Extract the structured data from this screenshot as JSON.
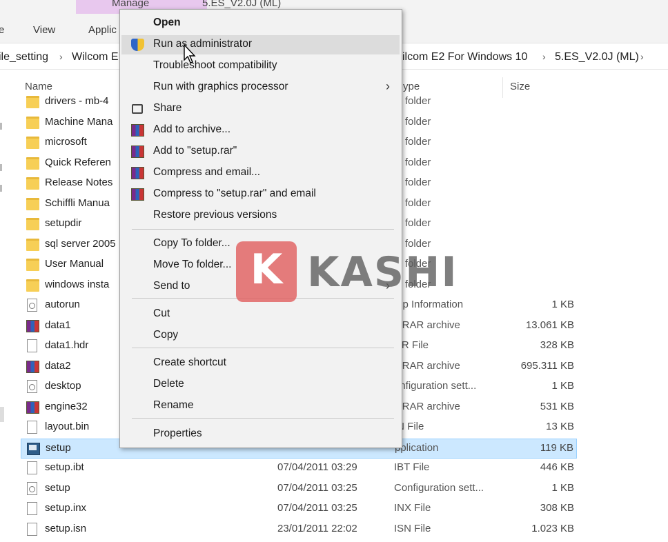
{
  "ribbon": {
    "manage_tab": "Manage",
    "window_title": "5.ES_V2.0J (ML)",
    "tab_file_fragment": "e",
    "tab_view": "View",
    "tab_application_fragment": "Applic"
  },
  "breadcrumb": {
    "left_fragment": "ile_setting",
    "wilcom_fragment": "Wilcom E",
    "right_fragment": "ilcom E2 For Windows 10",
    "current": "5.ES_V2.0J (ML)",
    "separator": "›"
  },
  "columns": {
    "name": "Name",
    "type_fragment": "ype",
    "size": "Size"
  },
  "files": [
    {
      "name": "drivers - mb-4",
      "date": "",
      "type": "le folder",
      "size": "",
      "icon": "folder-icon"
    },
    {
      "name": "Machine Mana",
      "date": "",
      "type": "le folder",
      "size": "",
      "icon": "folder-icon"
    },
    {
      "name": "microsoft",
      "date": "",
      "type": "le folder",
      "size": "",
      "icon": "folder-icon"
    },
    {
      "name": "Quick Referen",
      "date": "",
      "type": "le folder",
      "size": "",
      "icon": "folder-icon"
    },
    {
      "name": "Release Notes",
      "date": "",
      "type": "le folder",
      "size": "",
      "icon": "folder-icon"
    },
    {
      "name": "Schiffli Manua",
      "date": "",
      "type": "le folder",
      "size": "",
      "icon": "folder-icon"
    },
    {
      "name": "setupdir",
      "date": "",
      "type": "le folder",
      "size": "",
      "icon": "folder-icon"
    },
    {
      "name": "sql server 2005",
      "date": "",
      "type": "le folder",
      "size": "",
      "icon": "folder-icon"
    },
    {
      "name": "User Manual",
      "date": "",
      "type": "le folder",
      "size": "",
      "icon": "folder-icon"
    },
    {
      "name": "windows insta",
      "date": "",
      "type": "le folder",
      "size": "",
      "icon": "folder-icon"
    },
    {
      "name": "autorun",
      "date": "",
      "type": "tup Information",
      "size": "1 KB",
      "icon": "config-file-icon"
    },
    {
      "name": "data1",
      "date": "",
      "type": "inRAR archive",
      "size": "13.061 KB",
      "icon": "winrar-icon"
    },
    {
      "name": "data1.hdr",
      "date": "",
      "type": "DR File",
      "size": "328 KB",
      "icon": "document-icon"
    },
    {
      "name": "data2",
      "date": "",
      "type": "inRAR archive",
      "size": "695.311 KB",
      "icon": "winrar-icon"
    },
    {
      "name": "desktop",
      "date": "",
      "type": "onfiguration sett...",
      "size": "1 KB",
      "icon": "config-file-icon"
    },
    {
      "name": "engine32",
      "date": "",
      "type": "inRAR archive",
      "size": "531 KB",
      "icon": "winrar-icon"
    },
    {
      "name": "layout.bin",
      "date": "",
      "type": "IN File",
      "size": "13 KB",
      "icon": "document-icon"
    },
    {
      "name": "setup",
      "date": "",
      "type": "pplication",
      "size": "119 KB",
      "icon": "application-icon",
      "selected": true
    },
    {
      "name": "setup.ibt",
      "date": "07/04/2011 03:29",
      "type": "IBT File",
      "size": "446 KB",
      "icon": "document-icon"
    },
    {
      "name": "setup",
      "date": "07/04/2011 03:25",
      "type": "Configuration sett...",
      "size": "1 KB",
      "icon": "config-file-icon"
    },
    {
      "name": "setup.inx",
      "date": "07/04/2011 03:25",
      "type": "INX File",
      "size": "308 KB",
      "icon": "document-icon"
    },
    {
      "name": "setup.isn",
      "date": "23/01/2011 22:02",
      "type": "ISN File",
      "size": "1.023 KB",
      "icon": "document-icon"
    }
  ],
  "context_menu": {
    "items": [
      {
        "label": "Open",
        "bold": true
      },
      {
        "label": "Run as administrator",
        "icon": "uac-shield-icon",
        "hover": true
      },
      {
        "label": "Troubleshoot compatibility"
      },
      {
        "label": "Run with graphics processor",
        "submenu": true
      },
      {
        "label": "Share",
        "icon": "share-icon"
      },
      {
        "label": "Add to archive...",
        "icon": "winrar-icon"
      },
      {
        "label": "Add to \"setup.rar\"",
        "icon": "winrar-icon"
      },
      {
        "label": "Compress and email...",
        "icon": "winrar-icon"
      },
      {
        "label": "Compress to \"setup.rar\" and email",
        "icon": "winrar-icon"
      },
      {
        "label": "Restore previous versions"
      },
      {
        "label": "Copy To folder..."
      },
      {
        "label": "Move To folder..."
      },
      {
        "label": "Send to",
        "submenu": true
      },
      {
        "label": "Cut"
      },
      {
        "label": "Copy"
      },
      {
        "label": "Create shortcut"
      },
      {
        "label": "Delete"
      },
      {
        "label": "Rename"
      },
      {
        "label": "Properties"
      }
    ],
    "submenu_glyph": "›"
  },
  "watermark": {
    "letter": "K",
    "text": "KASHI",
    "color": "#e06060"
  },
  "colors": {
    "selection": "#cce8ff",
    "manage_tab": "#e8c8ee",
    "menu_bg": "#f2f2f2"
  }
}
